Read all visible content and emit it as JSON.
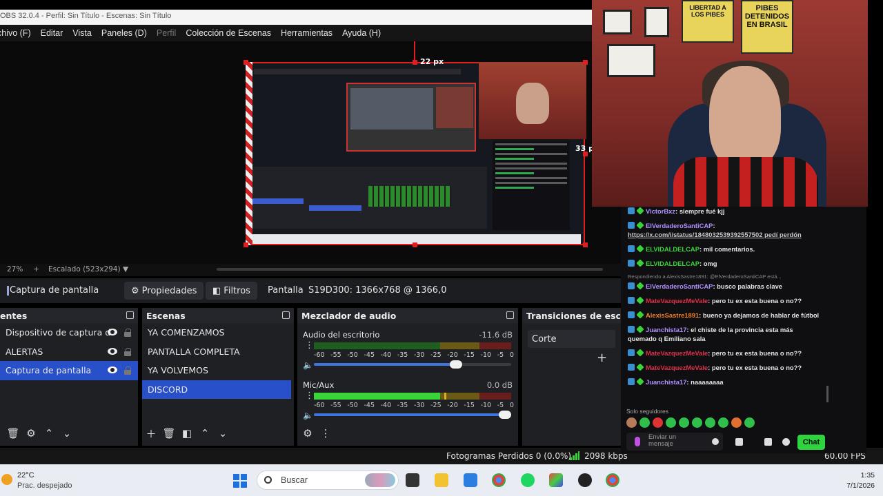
{
  "window": {
    "title": "OBS 32.0.4 - Perfil: Sin Título - Escenas: Sin Título"
  },
  "menu": [
    "chivo (F)",
    "Editar",
    "Vista",
    "Paneles (D)",
    "Perfil",
    "Colección de Escenas",
    "Herramientas",
    "Ayuda (H)"
  ],
  "preview": {
    "top_px_label": "22 px",
    "right_px_label": "33 p"
  },
  "scale": {
    "zoom": "27%",
    "mode": "Escalado (523x294)"
  },
  "context": {
    "source_name": "Captura de pantalla",
    "properties": "Propiedades",
    "filters": "Filtros",
    "display_label": "Pantalla",
    "display_value": "S19D300: 1366x768 @ 1366,0"
  },
  "sources": {
    "title": "entes",
    "items": [
      {
        "label": "Dispositivo de captura d",
        "selected": false
      },
      {
        "label": "ALERTAS",
        "selected": false
      },
      {
        "label": "Captura de pantalla",
        "selected": true
      }
    ]
  },
  "scenes": {
    "title": "Escenas",
    "items": [
      {
        "label": "YA COMENZAMOS",
        "selected": false
      },
      {
        "label": "PANTALLA COMPLETA",
        "selected": false
      },
      {
        "label": "YA VOLVEMOS",
        "selected": false
      },
      {
        "label": "DISCORD",
        "selected": true
      }
    ]
  },
  "mixer": {
    "title": "Mezclador de audio",
    "ticks": [
      "-60",
      "-55",
      "-50",
      "-45",
      "-40",
      "-35",
      "-30",
      "-25",
      "-20",
      "-15",
      "-10",
      "-5",
      "0"
    ],
    "channels": [
      {
        "name": "Audio del escritorio",
        "db": "-11.6 dB",
        "level": 0.0,
        "volume": 0.75
      },
      {
        "name": "Mic/Aux",
        "db": "0.0 dB",
        "level": 0.64,
        "peak": 0.66,
        "volume": 1.0
      }
    ]
  },
  "transitions": {
    "title": "Transiciones de escena",
    "selected": "Corte"
  },
  "status": {
    "dropped": "Fotogramas Perdidos 0 (0.0%)",
    "bitrate": "2098 kbps",
    "fps": "60.00 FPS"
  },
  "chat": {
    "messages": [
      {
        "user": "VictorBxz",
        "text": "siempre fué kjj",
        "color": "#b090ff"
      },
      {
        "user": "ElVerdaderoSantiCAP",
        "text": "https://x.com/i/status/1848032539392557502 pedí perdón",
        "color": "#b090ff",
        "link": true
      },
      {
        "user": "ELVIDALDELCAP",
        "text": "mil comentarios.",
        "color": "#3ad33a"
      },
      {
        "user": "ELVIDALDELCAP",
        "text": "omg",
        "color": "#3ad33a"
      },
      {
        "reply": "Respondiendo a AlexisSastre1891: @ElVerdaderoSantiCAP está..."
      },
      {
        "user": "ElVerdaderoSantiCAP",
        "text": "busco palabras clave",
        "color": "#b090ff"
      },
      {
        "user": "MateVazquezMeVale",
        "text": "pero tu ex esta buena o no??",
        "color": "#e0304a"
      },
      {
        "user": "AlexisSastre1891",
        "text": "bueno ya dejamos de hablar de fútbol",
        "color": "#f0802a"
      },
      {
        "user": "Juanchista17",
        "text": "el chiste de la provincia esta más quemado q Emiliano sala",
        "color": "#b090ff"
      },
      {
        "user": "MateVazquezMeVale",
        "text": "pero tu ex esta buena o no??",
        "color": "#e0304a"
      },
      {
        "user": "MateVazquezMeVale",
        "text": "pero tu ex esta buena o no??",
        "color": "#e0304a"
      },
      {
        "user": "Juanchista17",
        "text": "naaaaaaaa",
        "color": "#b090ff"
      }
    ],
    "followers_only": "Solo seguidores",
    "input_placeholder": "Enviar un mensaje",
    "send_label": "Chat"
  },
  "webcam": {
    "poster1": "LIBERTAD A LOS PIBES",
    "poster2": "PIBES DETENIDOS EN BRASIL"
  },
  "taskbar": {
    "temperature": "22°C",
    "weather": "Prac. despejado",
    "search_placeholder": "Buscar",
    "time": "1:35",
    "date": "7/1/2026"
  },
  "colors": {
    "accent": "#2850c8",
    "chat_button": "#2fd33f",
    "alert_red": "#e02020"
  }
}
